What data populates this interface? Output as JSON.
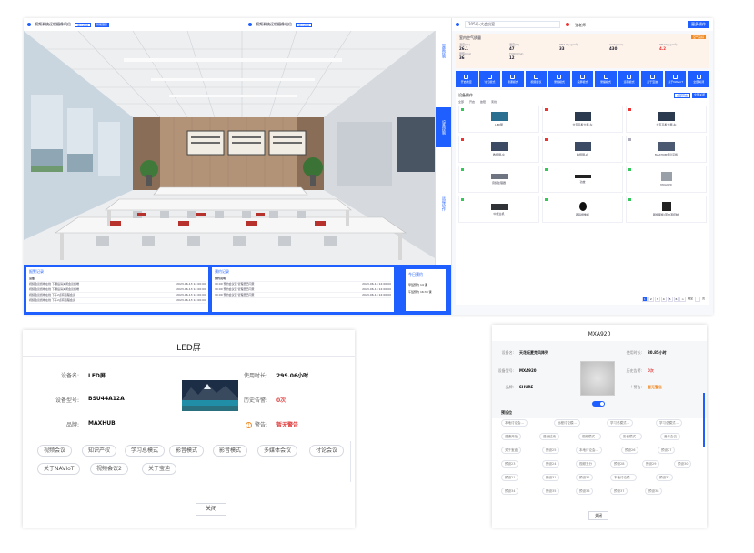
{
  "dashboard": {
    "cam_left": {
      "title": "视频系统远程摄像机位",
      "tag": "退出视频",
      "btn": "智能跟踪"
    },
    "cam_right": {
      "title": "视频系统远程摄像机位",
      "tag": "退出视频"
    },
    "vtabs": [
      "智能控制",
      "设备控制",
      "远程协作"
    ],
    "logs_left": {
      "title": "报警记录",
      "header": "设备",
      "rows": [
        {
          "text": "视频会议终端在线 下课后请关闭会议终端",
          "time": "2023-06-13 12:00:00"
        },
        {
          "text": "视频会议终端在线 下课后请关闭会议终端",
          "time": "2023-06-13 12:00:00"
        },
        {
          "text": "视频会议终端在线 下午2点有远程会议",
          "time": "2023-06-13 12:00:00"
        },
        {
          "text": "视频会议终端在线 下午2点有远程会议",
          "time": "2023-06-13 12:00:00"
        }
      ]
    },
    "logs_right": {
      "title": "预约记录",
      "header": "预约说明",
      "rows": [
        {
          "text": "10:00 预约会议室 管理员已同意",
          "time": "2023-06-13 12:00:00"
        },
        {
          "text": "10:00 预约会议室 管理员已同意",
          "time": "2023-06-13 12:00:00"
        },
        {
          "text": "10:00 预约会议室 管理员已同意",
          "time": "2023-06-13 12:00:00"
        }
      ]
    },
    "tempbox": {
      "title": "今日预约",
      "row1": "早班预约 14 课",
      "row2": "午班预约 16:30 课"
    }
  },
  "rpanel": {
    "search_placeholder": "205号-大会议室",
    "user": "张老师",
    "top_btn": "更多操作",
    "env_title": "室内空气质量",
    "env_tag": "空气良好",
    "env": [
      {
        "lbl": "温度(°C)",
        "val": "26.1"
      },
      {
        "lbl": "湿度(%)",
        "val": "47"
      },
      {
        "lbl": "PM2.5(μg/m³)",
        "val": "33"
      },
      {
        "lbl": "CO2(ppm)",
        "val": "430"
      },
      {
        "lbl": "PM10(μg/m³)",
        "val": "4.2"
      },
      {
        "lbl": "甲醛(mg)",
        "val": "36"
      },
      {
        "lbl": "TVOC(mg)",
        "val": "12"
      }
    ],
    "modes": [
      "开启教室",
      "讨论模式",
      "授课模式",
      "视频会议",
      "录播模式",
      "投屏模式",
      "录播模式",
      "远程模式",
      "关于宝迪",
      "关于NAVIoT",
      "全部关闭"
    ],
    "dev_title": "设备操作",
    "dev_btns": [
      "全部开启",
      "全部关闭"
    ],
    "filters": [
      "全部",
      "开启",
      "故障",
      "离线"
    ],
    "devices": [
      {
        "name": "LED屏",
        "status": "#34c759"
      },
      {
        "name": "交互平板大屏-左",
        "status": "#e33"
      },
      {
        "name": "交互平板大屏-右",
        "status": "#e33"
      },
      {
        "name": "教师屏-左",
        "status": "#e33"
      },
      {
        "name": "教师屏-右",
        "status": "#e33"
      },
      {
        "name": "MAXHUB会议平板",
        "status": "#aab"
      },
      {
        "name": "音频处理器",
        "status": "#34c759"
      },
      {
        "name": "功放",
        "status": "#34c759"
      },
      {
        "name": "MXA920",
        "status": "#34c759"
      },
      {
        "name": "中控主机",
        "status": "#34c759"
      },
      {
        "name": "跟踪摄像机",
        "status": "#34c759"
      },
      {
        "name": "网络面板(带电源控制)",
        "status": "#34c759"
      }
    ],
    "pager": [
      "1",
      "2",
      "3",
      "4",
      "5",
      "6",
      ">",
      "跳至",
      "页"
    ]
  },
  "led_dialog": {
    "title": "LED屏",
    "name_label": "设备名:",
    "name_value": "LED屏",
    "model_label": "设备型号:",
    "model_value": "BSU44A12A",
    "brand_label": "品牌:",
    "brand_value": "MAXHUB",
    "usage_label": "使用时长:",
    "usage_value": "299.06小时",
    "alerts_label": "历史告警:",
    "alerts_value": "0次",
    "warn_label": "警告:",
    "warn_value": "暂无警告",
    "chips": [
      "视频会议",
      "知识产权",
      "学习总模式",
      "影音模式",
      "影音模式",
      "多媒体会议",
      "讨论会议",
      "关于NAVIoT",
      "视频会议2",
      "关于宝迪"
    ],
    "close": "关闭"
  },
  "mxa_dialog": {
    "title": "MXA920",
    "name_label": "设备名:",
    "name_value": "天花板麦克风阵列",
    "model_label": "设备型号:",
    "model_value": "MXA920",
    "brand_label": "品牌:",
    "brand_value": "SHURE",
    "usage_label": "使用时长:",
    "usage_value": "80.85小时",
    "alerts_label": "历史告警:",
    "alerts_value": "0次",
    "warn_label": "警告:",
    "warn_value": "暂无警告",
    "preset_label": "预设位",
    "chips": [
      "本地讨论会...",
      "远程讨论模...",
      "学习总模式...",
      "学习总模式...",
      "普通开始",
      "普通结束",
      "视频模式...",
      "影音模式...",
      "音乐会议",
      "关于宝迪",
      "预设25",
      "本地讨论会...",
      "预设26",
      "预设27",
      "预设23",
      "预设24",
      "视频五分",
      "预设28",
      "预设29",
      "预设30",
      "预设21",
      "预设31",
      "预设32",
      "本地讨论模...",
      "预设33",
      "预设34",
      "预设35",
      "预设36",
      "预设37",
      "预设38"
    ],
    "close": "关闭"
  }
}
